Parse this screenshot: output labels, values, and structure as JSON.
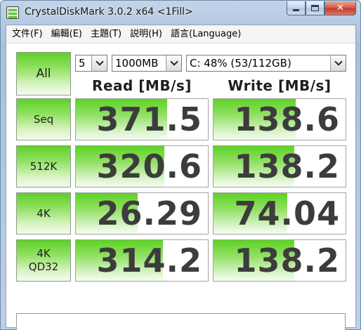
{
  "window": {
    "title": "CrystalDiskMark 3.0.2 x64 <1Fill>",
    "close_glyph": "✕"
  },
  "menu": [
    "文件(F)",
    "編輯(E)",
    "主題(T)",
    "説明(H)",
    "語言(Language)"
  ],
  "controls": {
    "all_label": "All",
    "count_value": "5",
    "size_value": "1000MB",
    "drive_value": "C: 48% (53/112GB)"
  },
  "headers": {
    "read": "Read [MB/s]",
    "write": "Write [MB/s]"
  },
  "tests": [
    {
      "label": "Seq",
      "read": "371.5",
      "write": "138.6",
      "read_fill": 0.69,
      "write_fill": 0.62
    },
    {
      "label": "512K",
      "read": "320.6",
      "write": "138.2",
      "read_fill": 0.67,
      "write_fill": 0.61
    },
    {
      "label": "4K",
      "read": "26.29",
      "write": "74.04",
      "read_fill": 0.47,
      "write_fill": 0.56
    },
    {
      "label": "4K\nQD32",
      "read": "314.2",
      "write": "138.2",
      "read_fill": 0.66,
      "write_fill": 0.61
    }
  ],
  "comment": "",
  "colors": {
    "accent_green": "#5dd224",
    "value_text": "#3c3c3c"
  }
}
